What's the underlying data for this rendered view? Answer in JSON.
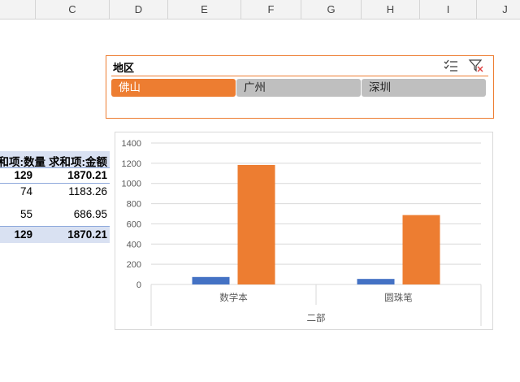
{
  "columns": [
    "C",
    "D",
    "E",
    "F",
    "G",
    "H",
    "I",
    "J"
  ],
  "pivot": {
    "headers": [
      "求和项:数量",
      "求和项:金额"
    ],
    "top_row": [
      "129",
      "1870.21"
    ],
    "rows": [
      [
        "74",
        "1183.26"
      ],
      [
        "55",
        "686.95"
      ]
    ],
    "total_row": [
      "129",
      "1870.21"
    ]
  },
  "slicer": {
    "title": "地区",
    "icons": [
      "multi-select-icon",
      "clear-filter-icon"
    ],
    "items": [
      {
        "label": "佛山",
        "selected": true
      },
      {
        "label": "广州",
        "selected": false
      },
      {
        "label": "深圳",
        "selected": false
      }
    ],
    "accent": "#ed7d31"
  },
  "chart_data": {
    "type": "bar",
    "categories": [
      "数学本",
      "圆珠笔"
    ],
    "group_label": "二部",
    "series": [
      {
        "values": [
          74,
          55
        ],
        "color": "#4472c4"
      },
      {
        "values": [
          1183.26,
          686.95
        ],
        "color": "#ed7d31"
      }
    ],
    "y_ticks": [
      "0",
      "200",
      "400",
      "600",
      "800",
      "1000",
      "1200",
      "1400"
    ],
    "ylim": [
      0,
      1400
    ],
    "grid": true
  }
}
